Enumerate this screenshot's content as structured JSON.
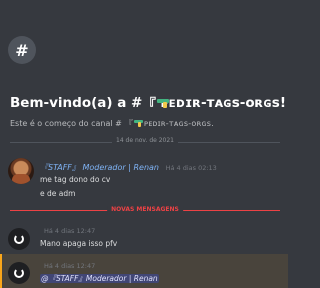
{
  "welcome": {
    "hash_symbol": "#",
    "title_prefix": "Bem-vindo(a) a #",
    "title_channel_open": "『",
    "title_channel_name": "ᴘᴇᴅɪʀ-ᴛᴀɢs-ᴏʀɢs!",
    "subtitle_prefix": "Este é o começo do canal #",
    "subtitle_channel_open": "『",
    "subtitle_channel_name": "ᴘᴇᴅɪʀ-ᴛᴀɢs-ᴏʀɢs."
  },
  "date_divider": "14 de nov. de 2021",
  "new_divider": "NOVAS MENSAGENS",
  "messages": [
    {
      "author": "『STAFF』 Moderador | Renan",
      "timestamp": "Há 4 dias 02:13",
      "lines": [
        "me tag dono do cv",
        "e de adm"
      ]
    },
    {
      "author": "",
      "timestamp": "Há 4 dias 12:47",
      "lines": [
        "Mano apaga isso pfv"
      ]
    },
    {
      "author": "",
      "timestamp": "Há 4 dias 12:47",
      "mention": "@『STAFF』Moderador | Renan"
    }
  ],
  "colors": {
    "background": "#36393f",
    "staff_name": "#7fb3f5",
    "new_messages": "#ed4245",
    "mention_bg": "#49443c",
    "mention_border": "#faa61a"
  }
}
